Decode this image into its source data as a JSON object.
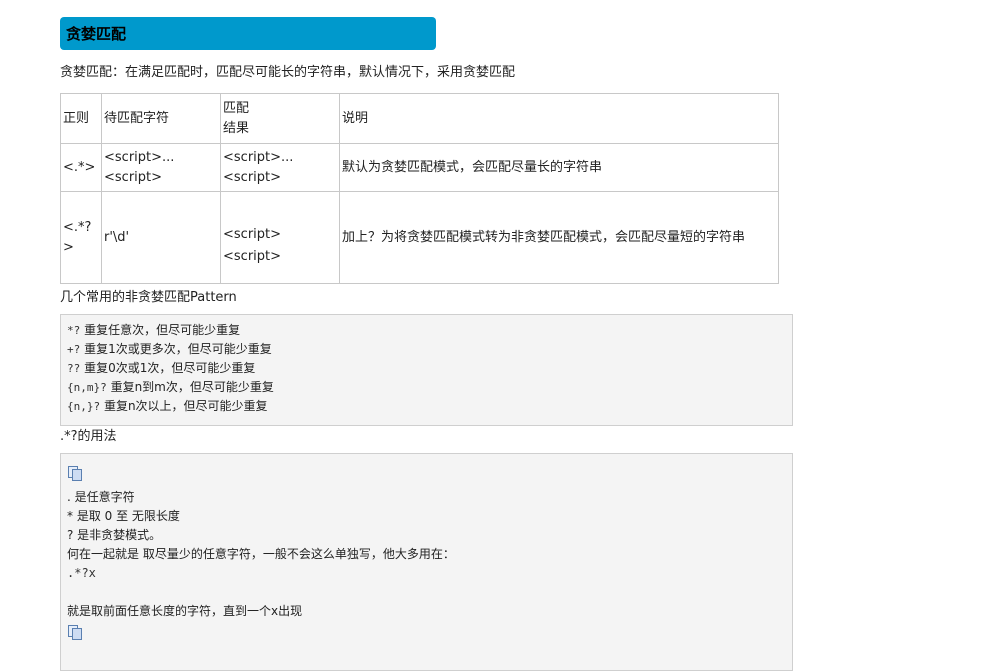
{
  "section": {
    "title": "贪婪匹配",
    "intro": "贪婪匹配：在满足匹配时，匹配尽可能长的字符串，默认情况下，采用贪婪匹配"
  },
  "table": {
    "headers": [
      "正则",
      "待匹配字符",
      "匹配",
      "结果",
      "说明"
    ],
    "rows": [
      {
        "regex": "<.*>",
        "input": "<script>...<script>",
        "result1": "<script>...<script>",
        "result2": "",
        "desc": "默认为贪婪匹配模式，会匹配尽量长的字符串"
      },
      {
        "regex": "<.*?>",
        "input": "r'\\d'",
        "result1": "<script>",
        "result2": "<script>",
        "desc": "加上？为将贪婪匹配模式转为非贪婪匹配模式，会匹配尽量短的字符串"
      }
    ]
  },
  "patterns": {
    "heading": "几个常用的非贪婪匹配Pattern",
    "lines": [
      {
        "code": "*?",
        "text": " 重复任意次，但尽可能少重复"
      },
      {
        "code": "+?",
        "text": " 重复1次或更多次，但尽可能少重复"
      },
      {
        "code": "??",
        "text": " 重复0次或1次，但尽可能少重复"
      },
      {
        "code": "{n,m}?",
        "text": " 重复n到m次，但尽可能少重复"
      },
      {
        "code": "{n,}?",
        "text": " 重复n次以上，但尽可能少重复"
      }
    ]
  },
  "usage": {
    "heading": ".*?的用法",
    "lines": [
      ". 是任意字符",
      "* 是取 0 至 无限长度",
      "? 是非贪婪模式。",
      "何在一起就是 取尽量少的任意字符，一般不会这么单独写，他大多用在：",
      ".*?x",
      "",
      "就是取前面任意长度的字符，直到一个x出现"
    ]
  }
}
